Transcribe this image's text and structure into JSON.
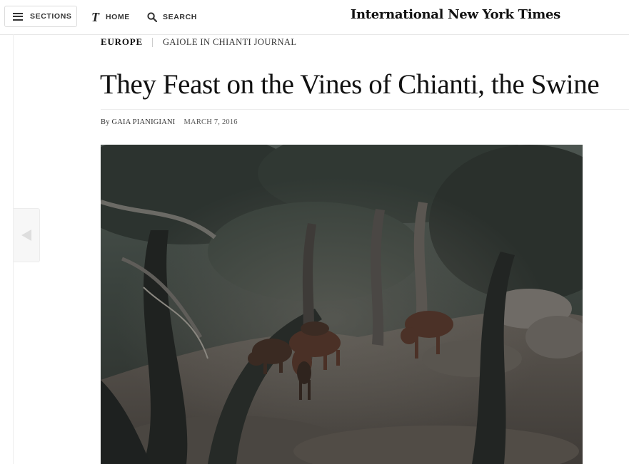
{
  "nav": {
    "sections_label": "SECTIONS",
    "home_label": "HOME",
    "home_logo": "T",
    "search_label": "SEARCH",
    "masthead": "International New York Times"
  },
  "article": {
    "section": "EUROPE",
    "column": "GAIOLE IN CHIANTI JOURNAL",
    "headline": "They Feast on the Vines of Chianti, the Swine",
    "byline": "By GAIA PIANIGIANI",
    "date": "MARCH 7, 2016"
  },
  "photo": {
    "subject": "wild boars in a forest"
  },
  "colors": {
    "text": "#111111",
    "rule": "#ececec",
    "photo_dark": "#2b2f2c"
  }
}
